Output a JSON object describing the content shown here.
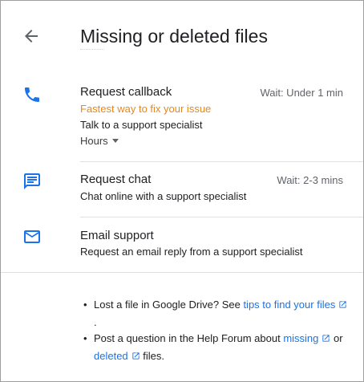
{
  "header": {
    "title": "Missing or deleted files",
    "back_icon": "arrow-back-icon"
  },
  "colors": {
    "accent": "#1a73e8",
    "highlight": "#e8871e",
    "divider": "#e0e0e0",
    "secondary_text": "#5f6368"
  },
  "options": [
    {
      "icon": "phone-icon",
      "title": "Request callback",
      "wait": "Wait: Under 1 min",
      "highlight": "Fastest way to fix your issue",
      "description": "Talk to a support specialist",
      "hours_label": "Hours"
    },
    {
      "icon": "chat-icon",
      "title": "Request chat",
      "wait": "Wait: 2-3 mins",
      "description": "Chat online with a support specialist"
    },
    {
      "icon": "email-icon",
      "title": "Email support",
      "description": "Request an email reply from a support specialist"
    }
  ],
  "resources": {
    "item1": {
      "bullet": "•",
      "text": "Lost a file in Google Drive? See ",
      "link": "tips to find your files",
      "trailing": "."
    },
    "item2": {
      "bullet": "•",
      "text": "Post a question in the Help Forum about ",
      "link1": "missing",
      "middle": " or",
      "link2": "deleted",
      "trailing": " files."
    }
  }
}
